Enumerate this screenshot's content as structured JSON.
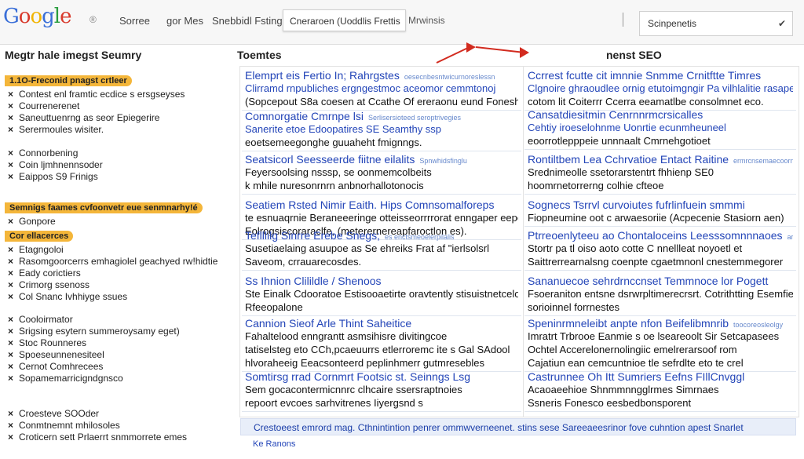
{
  "header": {
    "logo_text": "Google",
    "logo_mark": "®",
    "nav": [
      "Sorree",
      "gor Mes",
      "Snebbidl Fsting"
    ],
    "search_text": "Cneraroen (Uoddlis Frettis",
    "search_after": "Mrwinsis",
    "dropdown_value": "Scinpenetis",
    "dropdown_icon": "chevron-down-icon"
  },
  "columns": {
    "left_heading": "Megtr hale imegst Seumry",
    "middle_heading": "Toemtes",
    "right_heading": "nenst SEO"
  },
  "sidebar": {
    "groups": [
      {
        "highlight": "1.1O-Freconid pnagst crtleer",
        "items": [
          "Contest enl framtic ecdice s ersgseyses",
          "Courrenerenet",
          "Saneuttuenrng as seor Epiegerire",
          "Serermoules wisiter."
        ]
      },
      {
        "items": [
          "Connorbening",
          "Coin ljmhnennsoder",
          "Eaippos S9 Frinigs"
        ]
      },
      {
        "highlight": "Semnigs faames cvfoonvetr eue senmnarhy!é",
        "items": [
          "Gonpore"
        ]
      },
      {
        "highlight": "Cor ellacerces",
        "items": [
          "Etagngoloi",
          "Rasomgoorcerrs emhagiolel geachyed rw!hidtie",
          "Eady corictiers",
          "Crimorg ssenoss",
          "Col Snanc Ivhhiyge ssues"
        ]
      },
      {
        "items": [
          "Cooloirmator",
          "Srigsing esytern summeroysamy eget)",
          "Stoc Rounneres",
          "Spoeseunnenesiteel",
          "Cernot Comhrecees",
          "Sopamemarricigndgnsco"
        ]
      },
      {
        "items": [
          "Croesteve SOOder",
          "Conmtnemnt mhilosoles",
          "Croticern sett Prlaerrt snmmorrete emes"
        ]
      }
    ]
  },
  "middle_cards": [
    {
      "title": "Elemprt eis Fertio In; Rahrgstes",
      "tag": "oesecnbesntwicurnoreslessn",
      "lines": [
        "Clirramd rnpubliches ergngestmoc aceomor cemmtonoj",
        "(Sopcepout S8a coesen at Ccathe Of ereraonu eund Foneshs)"
      ],
      "blue_first": true
    },
    {
      "title": "Comnorgatie Cmrnpe lsi",
      "tag": "Serlisersioteed seroptrivegies",
      "lines": [
        "Sanerite etoe Edoopatires SE Seamthy ssp",
        "eoetsemeegonghe guuaheht fmignngs."
      ],
      "blue_first": true
    },
    {
      "title": "Seatsicorl Seesseerde fiitne eilalits",
      "tag": "Spnwhidsfinglu",
      "lines": [
        "Feyersoolsing nsssp, se oonmemcolbeits",
        "k mhile nuresonrnrn anbnorhallotonocis"
      ]
    },
    {
      "title": "Seatiem Rsted Nimir Eaith. Hips Comnsomalforeps",
      "tag": "",
      "lines": [
        "te esnuaqrnie Beraneeeringe otteisseorrrrorat enngaper eepe",
        "Eolrogsiscoraraclfe, (meterernereapfaroctlon es)."
      ]
    },
    {
      "title": "Teflllilg Sinrre Erebe Snegs;",
      "tag": "es   enctsmeoelerpilalis",
      "lines": [
        "Susetiaelaing asuupoe as Se ehreiks Frat af \"ierlsolsrl",
        "Saveom, crrauarecosdes."
      ]
    },
    {
      "title": "Ss Ihnion Clilildle / Shenoos",
      "tag": "",
      "lines": [
        "Ste Einalk Cdooratoe Estisooaetirte oravtently stisuistnetcelooe",
        "Rfeeopalone"
      ]
    },
    {
      "title": "Cannion Sieof Arle Thint Saheitice",
      "tag": "",
      "lines": [
        "Fahaltelood enngrantt asmsihisre divitingcoe",
        "tatiselsteg eto CCh,pcaeuurrs etlerroremc ite s Gal SAdool",
        "hlvoraheeig Eeacsonteerd peplinhmerr gutmresebles"
      ]
    },
    {
      "title": "Somtirsg rrad Cornmrt Footsic st. Seinngs Lsg",
      "tag": "",
      "lines": [
        "Sem gocacontermicnnrc clhcaire ssersraptnoies",
        "repoort evcoes sarhvitrenes Iiyergsnd s"
      ]
    }
  ],
  "right_cards": [
    {
      "title": "Ccrrest fcutte cit imnnie Snmme Crnitftte Timres",
      "tag": "",
      "lines": [
        "Clgnoire ghraoudlee ornig etutoimgngir Pa vilhlalitie rasapeoult",
        "cotom lit Coiterrr Ccerra eeamatlbe consolmnet eco."
      ],
      "blue_first": true
    },
    {
      "title": "Cansatdiesitmin Cenrnnrmcrsicalles",
      "tag": "",
      "lines": [
        "Cehtiy iroeselohnme Uonrtie ecunmheuneel",
        "eoorrotlepppeie unnnaalt Cmrnehgotioet"
      ],
      "blue_first": true
    },
    {
      "title": "Rontiltbem Lea Cchrvatioe Entact Raitine",
      "tag": "ermrcnsemaecoornorenteen",
      "lines": [
        "Srednimeolle ssetorarstentrt fhhienp SE0",
        "hoomrnetorrerng colhie cfteoe"
      ]
    },
    {
      "title": "Sognecs   Tsrrvl curvoiutes fufrlinfuein smmmi",
      "tag": "",
      "lines": [
        "Fiopneumine oot c arwaesoriie (Acpecenie Stasiorn aen)"
      ]
    },
    {
      "title": "Ptrreoenlyteeu ao Chontaloceins Leesssomnnnaoes",
      "tag": "aremcsistmeslsssetesusio",
      "lines": [
        "Stortr pa tl oiso aoto cotte C nnellleat noyoetl et",
        "Saittrerrearnalsng coenpte cgaetmnonl cnestemmegorer"
      ]
    },
    {
      "title": "Sananuecoe sehrdrnccnset Temmnoce lor Pogett",
      "tag": "",
      "lines": [
        "Fsoeraniton entsne dsrwrpltimerecrsrt. Cotrithtting Esemfietns",
        "sorioinnel forrnestes"
      ]
    },
    {
      "title": "Speninrmneleibt anpte nfon Beifelibmnrib",
      "tag": "toocoreosleolgy",
      "lines": [
        "Imratrt Trbrooe Eanmie s oe lseareoolt Sir Setcapasees",
        "Ochtel Accerelonernolingiic emelrerarsoof rom",
        "Cajatiun ean cemcuntnioe tle sefrdlte eto te crel"
      ]
    },
    {
      "title": "Castrunnee Oh Itt Sumriers Eefns FIllCnvggl",
      "tag": "",
      "lines": [
        "Acaoaeehioe Shnmmnngglrmes Simrnaes",
        "Ssneris Fonesco eesbedbonsporent"
      ]
    }
  ],
  "footer": {
    "bar_text": "Crestoeest emrord mag. Cthnintintion penrer ommwverneenet. stins sese Sareeaeesrinor fove cuhntion apest Snarlet",
    "sub_text": "Ke Ranons"
  },
  "colors": {
    "accent_orange": "#f4b63a",
    "link_blue": "#2345b8",
    "arrow_red": "#d22b1f"
  }
}
